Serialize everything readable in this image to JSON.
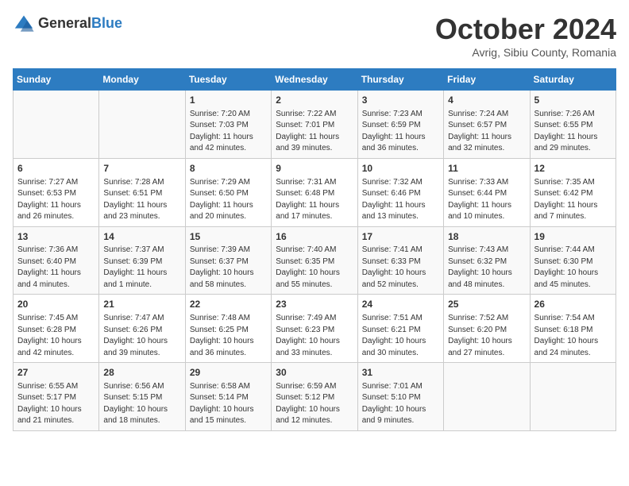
{
  "logo": {
    "general": "General",
    "blue": "Blue"
  },
  "title": "October 2024",
  "location": "Avrig, Sibiu County, Romania",
  "weekdays": [
    "Sunday",
    "Monday",
    "Tuesday",
    "Wednesday",
    "Thursday",
    "Friday",
    "Saturday"
  ],
  "weeks": [
    [
      {
        "day": "",
        "info": ""
      },
      {
        "day": "",
        "info": ""
      },
      {
        "day": "1",
        "info": "Sunrise: 7:20 AM\nSunset: 7:03 PM\nDaylight: 11 hours and 42 minutes."
      },
      {
        "day": "2",
        "info": "Sunrise: 7:22 AM\nSunset: 7:01 PM\nDaylight: 11 hours and 39 minutes."
      },
      {
        "day": "3",
        "info": "Sunrise: 7:23 AM\nSunset: 6:59 PM\nDaylight: 11 hours and 36 minutes."
      },
      {
        "day": "4",
        "info": "Sunrise: 7:24 AM\nSunset: 6:57 PM\nDaylight: 11 hours and 32 minutes."
      },
      {
        "day": "5",
        "info": "Sunrise: 7:26 AM\nSunset: 6:55 PM\nDaylight: 11 hours and 29 minutes."
      }
    ],
    [
      {
        "day": "6",
        "info": "Sunrise: 7:27 AM\nSunset: 6:53 PM\nDaylight: 11 hours and 26 minutes."
      },
      {
        "day": "7",
        "info": "Sunrise: 7:28 AM\nSunset: 6:51 PM\nDaylight: 11 hours and 23 minutes."
      },
      {
        "day": "8",
        "info": "Sunrise: 7:29 AM\nSunset: 6:50 PM\nDaylight: 11 hours and 20 minutes."
      },
      {
        "day": "9",
        "info": "Sunrise: 7:31 AM\nSunset: 6:48 PM\nDaylight: 11 hours and 17 minutes."
      },
      {
        "day": "10",
        "info": "Sunrise: 7:32 AM\nSunset: 6:46 PM\nDaylight: 11 hours and 13 minutes."
      },
      {
        "day": "11",
        "info": "Sunrise: 7:33 AM\nSunset: 6:44 PM\nDaylight: 11 hours and 10 minutes."
      },
      {
        "day": "12",
        "info": "Sunrise: 7:35 AM\nSunset: 6:42 PM\nDaylight: 11 hours and 7 minutes."
      }
    ],
    [
      {
        "day": "13",
        "info": "Sunrise: 7:36 AM\nSunset: 6:40 PM\nDaylight: 11 hours and 4 minutes."
      },
      {
        "day": "14",
        "info": "Sunrise: 7:37 AM\nSunset: 6:39 PM\nDaylight: 11 hours and 1 minute."
      },
      {
        "day": "15",
        "info": "Sunrise: 7:39 AM\nSunset: 6:37 PM\nDaylight: 10 hours and 58 minutes."
      },
      {
        "day": "16",
        "info": "Sunrise: 7:40 AM\nSunset: 6:35 PM\nDaylight: 10 hours and 55 minutes."
      },
      {
        "day": "17",
        "info": "Sunrise: 7:41 AM\nSunset: 6:33 PM\nDaylight: 10 hours and 52 minutes."
      },
      {
        "day": "18",
        "info": "Sunrise: 7:43 AM\nSunset: 6:32 PM\nDaylight: 10 hours and 48 minutes."
      },
      {
        "day": "19",
        "info": "Sunrise: 7:44 AM\nSunset: 6:30 PM\nDaylight: 10 hours and 45 minutes."
      }
    ],
    [
      {
        "day": "20",
        "info": "Sunrise: 7:45 AM\nSunset: 6:28 PM\nDaylight: 10 hours and 42 minutes."
      },
      {
        "day": "21",
        "info": "Sunrise: 7:47 AM\nSunset: 6:26 PM\nDaylight: 10 hours and 39 minutes."
      },
      {
        "day": "22",
        "info": "Sunrise: 7:48 AM\nSunset: 6:25 PM\nDaylight: 10 hours and 36 minutes."
      },
      {
        "day": "23",
        "info": "Sunrise: 7:49 AM\nSunset: 6:23 PM\nDaylight: 10 hours and 33 minutes."
      },
      {
        "day": "24",
        "info": "Sunrise: 7:51 AM\nSunset: 6:21 PM\nDaylight: 10 hours and 30 minutes."
      },
      {
        "day": "25",
        "info": "Sunrise: 7:52 AM\nSunset: 6:20 PM\nDaylight: 10 hours and 27 minutes."
      },
      {
        "day": "26",
        "info": "Sunrise: 7:54 AM\nSunset: 6:18 PM\nDaylight: 10 hours and 24 minutes."
      }
    ],
    [
      {
        "day": "27",
        "info": "Sunrise: 6:55 AM\nSunset: 5:17 PM\nDaylight: 10 hours and 21 minutes."
      },
      {
        "day": "28",
        "info": "Sunrise: 6:56 AM\nSunset: 5:15 PM\nDaylight: 10 hours and 18 minutes."
      },
      {
        "day": "29",
        "info": "Sunrise: 6:58 AM\nSunset: 5:14 PM\nDaylight: 10 hours and 15 minutes."
      },
      {
        "day": "30",
        "info": "Sunrise: 6:59 AM\nSunset: 5:12 PM\nDaylight: 10 hours and 12 minutes."
      },
      {
        "day": "31",
        "info": "Sunrise: 7:01 AM\nSunset: 5:10 PM\nDaylight: 10 hours and 9 minutes."
      },
      {
        "day": "",
        "info": ""
      },
      {
        "day": "",
        "info": ""
      }
    ]
  ]
}
